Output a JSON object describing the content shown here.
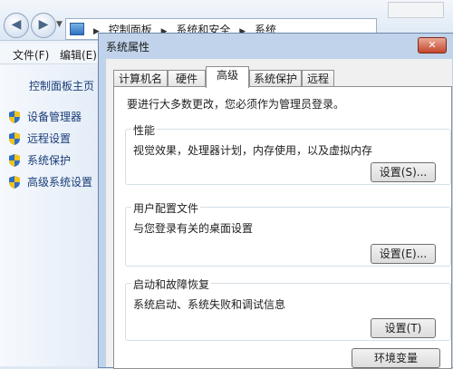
{
  "explorer": {
    "breadcrumbs": [
      "控制面板",
      "系统和安全",
      "系统"
    ],
    "menu": [
      "文件(F)",
      "编辑(E)"
    ],
    "sidebar": {
      "home": "控制面板主页",
      "links": [
        {
          "label": "设备管理器",
          "icon": "shield-icon"
        },
        {
          "label": "远程设置",
          "icon": "shield-icon"
        },
        {
          "label": "系统保护",
          "icon": "shield-icon"
        },
        {
          "label": "高级系统设置",
          "icon": "shield-icon"
        }
      ]
    }
  },
  "dialog": {
    "title": "系统属性",
    "close_symbol": "✕",
    "tabs": [
      "计算机名",
      "硬件",
      "高级",
      "系统保护",
      "远程"
    ],
    "active_tab": "高级",
    "admin_note": "要进行大多数更改，您必须作为管理员登录。",
    "groups": [
      {
        "legend": "性能",
        "desc": "视觉效果，处理器计划，内存使用，以及虚拟内存",
        "button": "设置(S)..."
      },
      {
        "legend": "用户配置文件",
        "desc": "与您登录有关的桌面设置",
        "button": "设置(E)..."
      },
      {
        "legend": "启动和故障恢复",
        "desc": "系统启动、系统失败和调试信息",
        "button": "设置(T)"
      }
    ],
    "env_button": "环境变量"
  },
  "colors": {
    "accent": "#1a3d78",
    "close": "#c4472c",
    "shield_blue": "#2f6fc4",
    "shield_yellow": "#f2c419"
  }
}
